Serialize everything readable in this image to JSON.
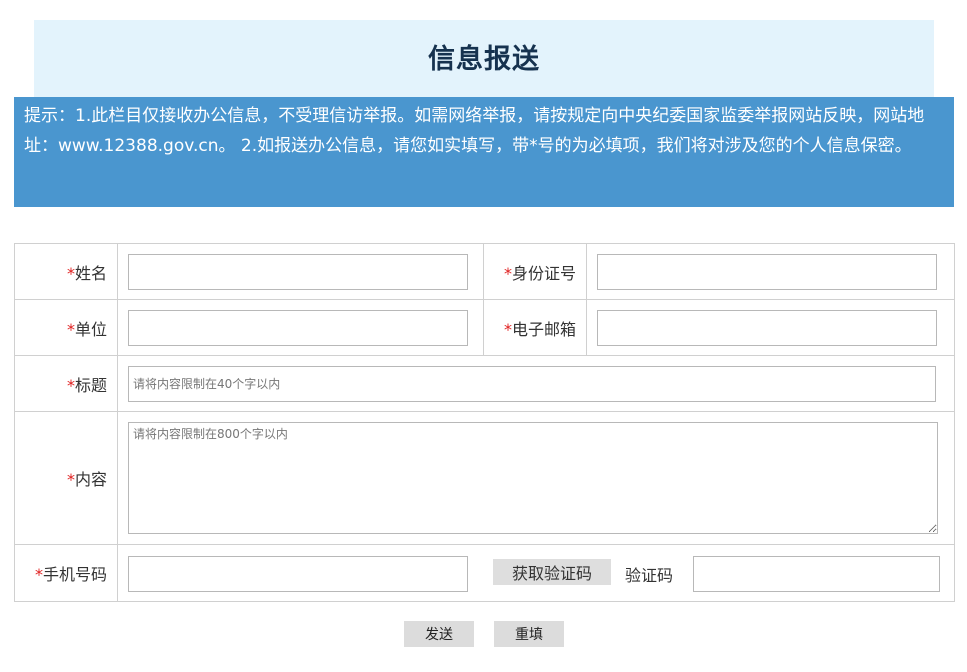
{
  "page": {
    "title": "信息报送",
    "notice": "提示：1.此栏目仅接收办公信息，不受理信访举报。如需网络举报，请按规定向中央纪委国家监委举报网站反映，网站地址：www.12388.gov.cn。 2.如报送办公信息，请您如实填写，带*号的为必填项，我们将对涉及您的个人信息保密。"
  },
  "form": {
    "required_mark": "*",
    "name_label": "姓名",
    "id_label": "身份证号",
    "unit_label": "单位",
    "email_label": "电子邮箱",
    "subject_label": "标题",
    "subject_placeholder": "请将内容限制在40个字以内",
    "content_label": "内容",
    "content_placeholder": "请将内容限制在800个字以内",
    "phone_label": "手机号码",
    "get_code_label": "获取验证码",
    "code_label": "验证码"
  },
  "actions": {
    "send_label": "发送",
    "reset_label": "重填"
  },
  "colors": {
    "title_bg": "#e3f3fc",
    "title_text": "#16324f",
    "notice_bg": "#4a96cf",
    "required": "#e02020"
  }
}
